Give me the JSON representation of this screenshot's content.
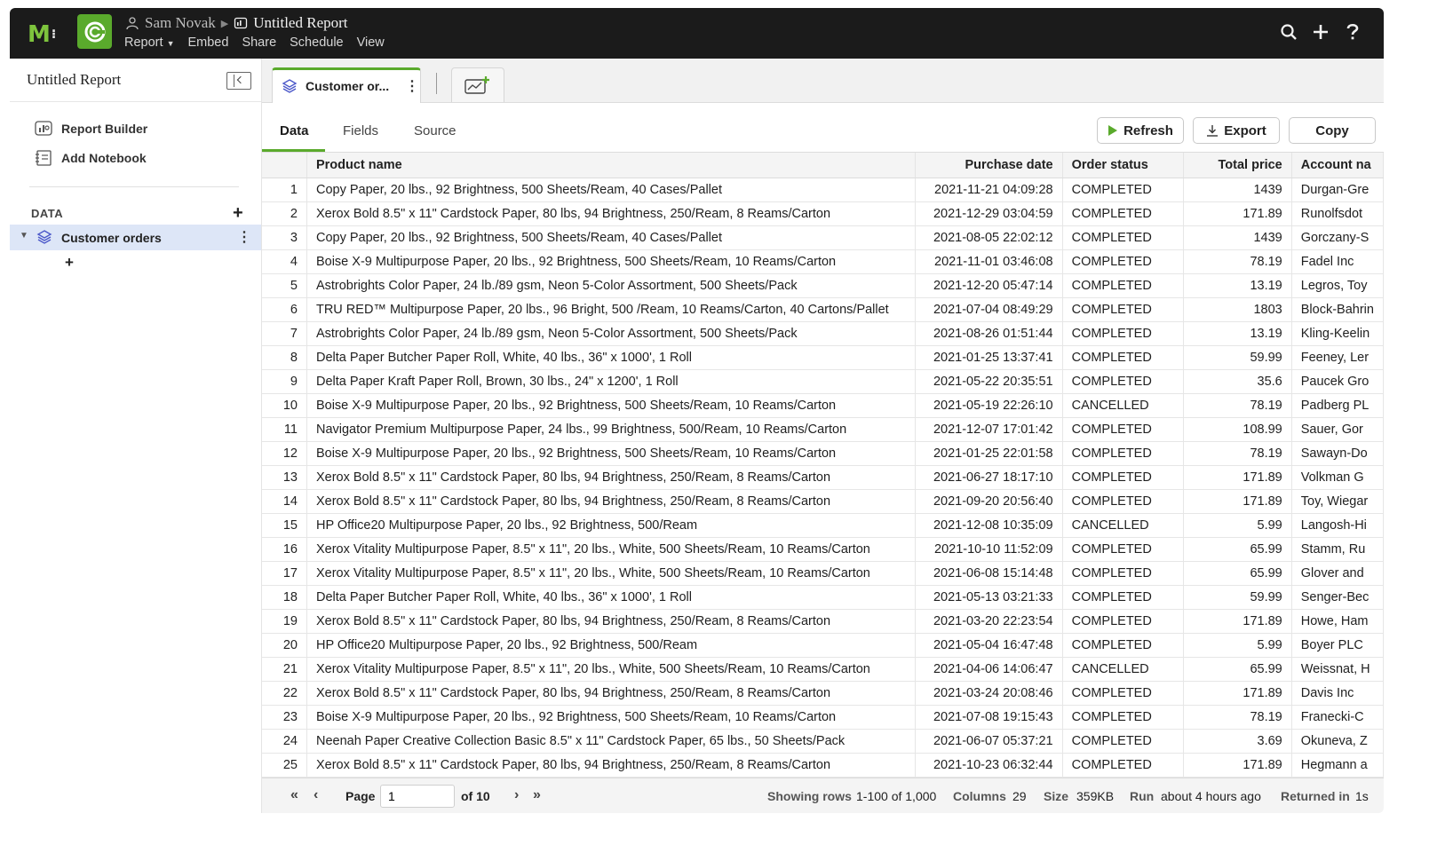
{
  "topbar": {
    "logo": "M",
    "user": "Sam Novak",
    "report_title": "Untitled Report",
    "menu": [
      "Report",
      "Embed",
      "Share",
      "Schedule",
      "View"
    ]
  },
  "sidebar": {
    "title": "Untitled Report",
    "items": [
      "Report Builder",
      "Add Notebook"
    ],
    "data_section": "DATA",
    "dataset": "Customer orders"
  },
  "main": {
    "tab_label": "Customer or...",
    "subtabs": [
      "Data",
      "Fields",
      "Source"
    ],
    "buttons": {
      "refresh": "Refresh",
      "export": "Export",
      "copy": "Copy"
    }
  },
  "table": {
    "columns": [
      "Product name",
      "Purchase date",
      "Order status",
      "Total price",
      "Account na"
    ],
    "rows": [
      [
        "1",
        "Copy Paper, 20 lbs., 92 Brightness, 500 Sheets/Ream, 40 Cases/Pallet",
        "2021-11-21 04:09:28",
        "COMPLETED",
        "1439",
        "Durgan-Gre"
      ],
      [
        "2",
        "Xerox Bold 8.5\" x 11\" Cardstock Paper, 80 lbs, 94 Brightness, 250/Ream, 8 Reams/Carton",
        "2021-12-29 03:04:59",
        "COMPLETED",
        "171.89",
        "Runolfsdot"
      ],
      [
        "3",
        "Copy Paper, 20 lbs., 92 Brightness, 500 Sheets/Ream, 40 Cases/Pallet",
        "2021-08-05 22:02:12",
        "COMPLETED",
        "1439",
        "Gorczany-S"
      ],
      [
        "4",
        "Boise X-9 Multipurpose Paper, 20 lbs., 92 Brightness, 500 Sheets/Ream, 10 Reams/Carton",
        "2021-11-01 03:46:08",
        "COMPLETED",
        "78.19",
        "Fadel Inc"
      ],
      [
        "5",
        "Astrobrights Color Paper, 24 lb./89 gsm, Neon 5-Color Assortment, 500 Sheets/Pack",
        "2021-12-20 05:47:14",
        "COMPLETED",
        "13.19",
        "Legros, Toy"
      ],
      [
        "6",
        "TRU RED™ Multipurpose Paper, 20 lbs., 96 Bright, 500 /Ream, 10 Reams/Carton, 40 Cartons/Pallet",
        "2021-07-04 08:49:29",
        "COMPLETED",
        "1803",
        "Block-Bahrin"
      ],
      [
        "7",
        "Astrobrights Color Paper, 24 lb./89 gsm, Neon 5-Color Assortment, 500 Sheets/Pack",
        "2021-08-26 01:51:44",
        "COMPLETED",
        "13.19",
        "Kling-Keelin"
      ],
      [
        "8",
        "Delta Paper Butcher Paper Roll, White, 40 lbs., 36\" x 1000', 1 Roll",
        "2021-01-25 13:37:41",
        "COMPLETED",
        "59.99",
        "Feeney, Ler"
      ],
      [
        "9",
        "Delta Paper Kraft Paper Roll, Brown, 30 lbs., 24\" x 1200', 1 Roll",
        "2021-05-22 20:35:51",
        "COMPLETED",
        "35.6",
        "Paucek Gro"
      ],
      [
        "10",
        "Boise X-9 Multipurpose Paper, 20 lbs., 92 Brightness, 500 Sheets/Ream, 10 Reams/Carton",
        "2021-05-19 22:26:10",
        "CANCELLED",
        "78.19",
        "Padberg PL"
      ],
      [
        "11",
        "Navigator Premium Multipurpose Paper, 24 lbs., 99 Brightness, 500/Ream, 10 Reams/Carton",
        "2021-12-07 17:01:42",
        "COMPLETED",
        "108.99",
        "Sauer, Gor"
      ],
      [
        "12",
        "Boise X-9 Multipurpose Paper, 20 lbs., 92 Brightness, 500 Sheets/Ream, 10 Reams/Carton",
        "2021-01-25 22:01:58",
        "COMPLETED",
        "78.19",
        "Sawayn-Do"
      ],
      [
        "13",
        "Xerox Bold 8.5\" x 11\" Cardstock Paper, 80 lbs, 94 Brightness, 250/Ream, 8 Reams/Carton",
        "2021-06-27 18:17:10",
        "COMPLETED",
        "171.89",
        "Volkman G"
      ],
      [
        "14",
        "Xerox Bold 8.5\" x 11\" Cardstock Paper, 80 lbs, 94 Brightness, 250/Ream, 8 Reams/Carton",
        "2021-09-20 20:56:40",
        "COMPLETED",
        "171.89",
        "Toy, Wiegar"
      ],
      [
        "15",
        "HP Office20 Multipurpose Paper, 20 lbs., 92 Brightness, 500/Ream",
        "2021-12-08 10:35:09",
        "CANCELLED",
        "5.99",
        "Langosh-Hi"
      ],
      [
        "16",
        "Xerox Vitality Multipurpose Paper, 8.5\" x 11\", 20 lbs., White, 500 Sheets/Ream, 10 Reams/Carton",
        "2021-10-10 11:52:09",
        "COMPLETED",
        "65.99",
        "Stamm, Ru"
      ],
      [
        "17",
        "Xerox Vitality Multipurpose Paper, 8.5\" x 11\", 20 lbs., White, 500 Sheets/Ream, 10 Reams/Carton",
        "2021-06-08 15:14:48",
        "COMPLETED",
        "65.99",
        "Glover and"
      ],
      [
        "18",
        "Delta Paper Butcher Paper Roll, White, 40 lbs., 36\" x 1000', 1 Roll",
        "2021-05-13 03:21:33",
        "COMPLETED",
        "59.99",
        "Senger-Bec"
      ],
      [
        "19",
        "Xerox Bold 8.5\" x 11\" Cardstock Paper, 80 lbs, 94 Brightness, 250/Ream, 8 Reams/Carton",
        "2021-03-20 22:23:54",
        "COMPLETED",
        "171.89",
        "Howe, Ham"
      ],
      [
        "20",
        "HP Office20 Multipurpose Paper, 20 lbs., 92 Brightness, 500/Ream",
        "2021-05-04 16:47:48",
        "COMPLETED",
        "5.99",
        "Boyer PLC"
      ],
      [
        "21",
        "Xerox Vitality Multipurpose Paper, 8.5\" x 11\", 20 lbs., White, 500 Sheets/Ream, 10 Reams/Carton",
        "2021-04-06 14:06:47",
        "CANCELLED",
        "65.99",
        "Weissnat, H"
      ],
      [
        "22",
        "Xerox Bold 8.5\" x 11\" Cardstock Paper, 80 lbs, 94 Brightness, 250/Ream, 8 Reams/Carton",
        "2021-03-24 20:08:46",
        "COMPLETED",
        "171.89",
        "Davis Inc"
      ],
      [
        "23",
        "Boise X-9 Multipurpose Paper, 20 lbs., 92 Brightness, 500 Sheets/Ream, 10 Reams/Carton",
        "2021-07-08 19:15:43",
        "COMPLETED",
        "78.19",
        "Franecki-C"
      ],
      [
        "24",
        "Neenah Paper Creative Collection Basic 8.5\" x 11\" Cardstock Paper, 65 lbs., 50 Sheets/Pack",
        "2021-06-07 05:37:21",
        "COMPLETED",
        "3.69",
        "Okuneva, Z"
      ],
      [
        "25",
        "Xerox Bold 8.5\" x 11\" Cardstock Paper, 80 lbs, 94 Brightness, 250/Ream, 8 Reams/Carton",
        "2021-10-23 06:32:44",
        "COMPLETED",
        "171.89",
        "Hegmann a"
      ]
    ]
  },
  "footer": {
    "page_label": "Page",
    "page_value": "1",
    "page_of": "of 10",
    "showing_label": "Showing rows",
    "showing_value": "1-100 of 1,000",
    "columns_label": "Columns",
    "columns_value": "29",
    "size_label": "Size",
    "size_value": "359KB",
    "run_label": "Run",
    "run_value": "about 4 hours ago",
    "returned_label": "Returned in",
    "returned_value": "1s"
  },
  "colors": {
    "accent": "#5aaa2c",
    "topbar": "#1b1b1b",
    "dataset_icon": "#4a57c9",
    "selection": "#dde6f7"
  }
}
